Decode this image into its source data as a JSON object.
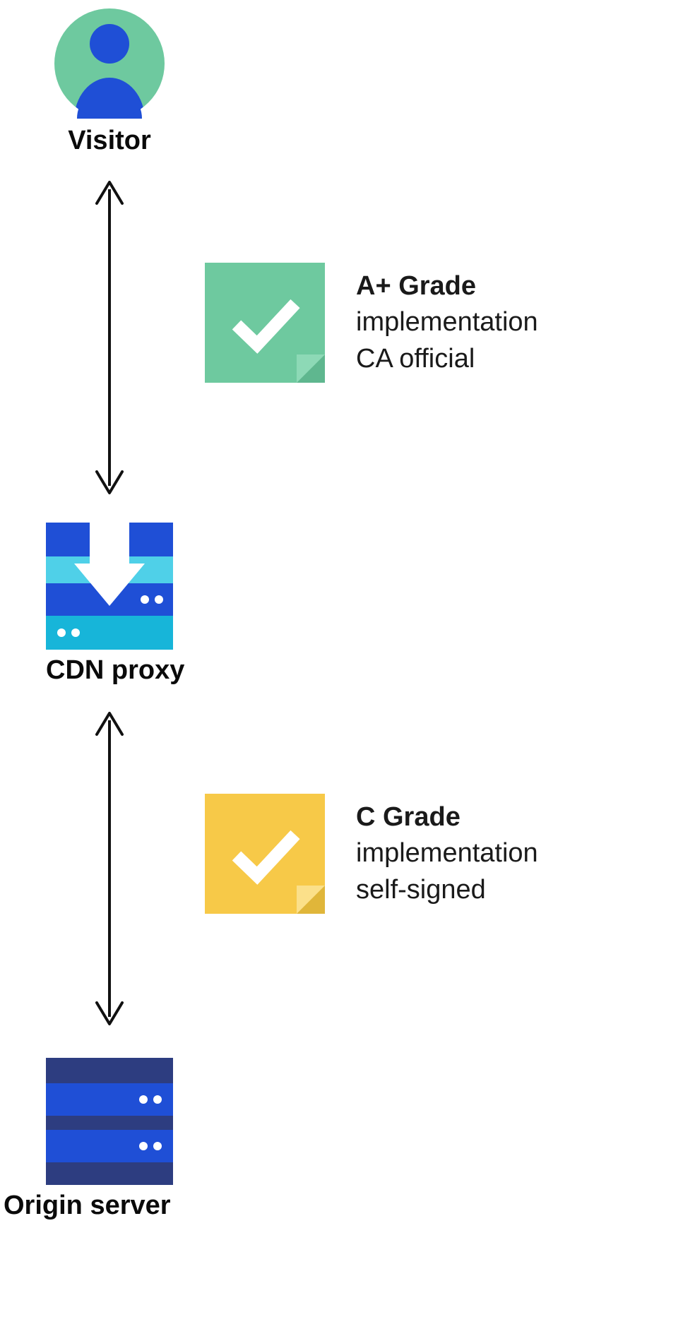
{
  "nodes": {
    "visitor": {
      "label": "Visitor"
    },
    "cdn": {
      "label": "CDN proxy"
    },
    "origin": {
      "label": "Origin server"
    }
  },
  "badges": {
    "top": {
      "title": "A+ Grade",
      "line1": "implementation",
      "line2": "CA official",
      "color": "#6ec99f"
    },
    "bottom": {
      "title": "C Grade",
      "line1": "implementation",
      "line2": "self-signed",
      "color": "#f7c948"
    }
  },
  "colors": {
    "avatar_bg": "#6ec99f",
    "avatar_fg": "#1f4fd6",
    "cdn_dark_blue": "#1f4fd6",
    "cdn_cyan": "#17b5d9",
    "cdn_light_cyan": "#4fd0e8",
    "server_navy": "#2d3d80",
    "server_blue": "#1f4fd6",
    "arrow": "#111111",
    "check": "#ffffff"
  }
}
